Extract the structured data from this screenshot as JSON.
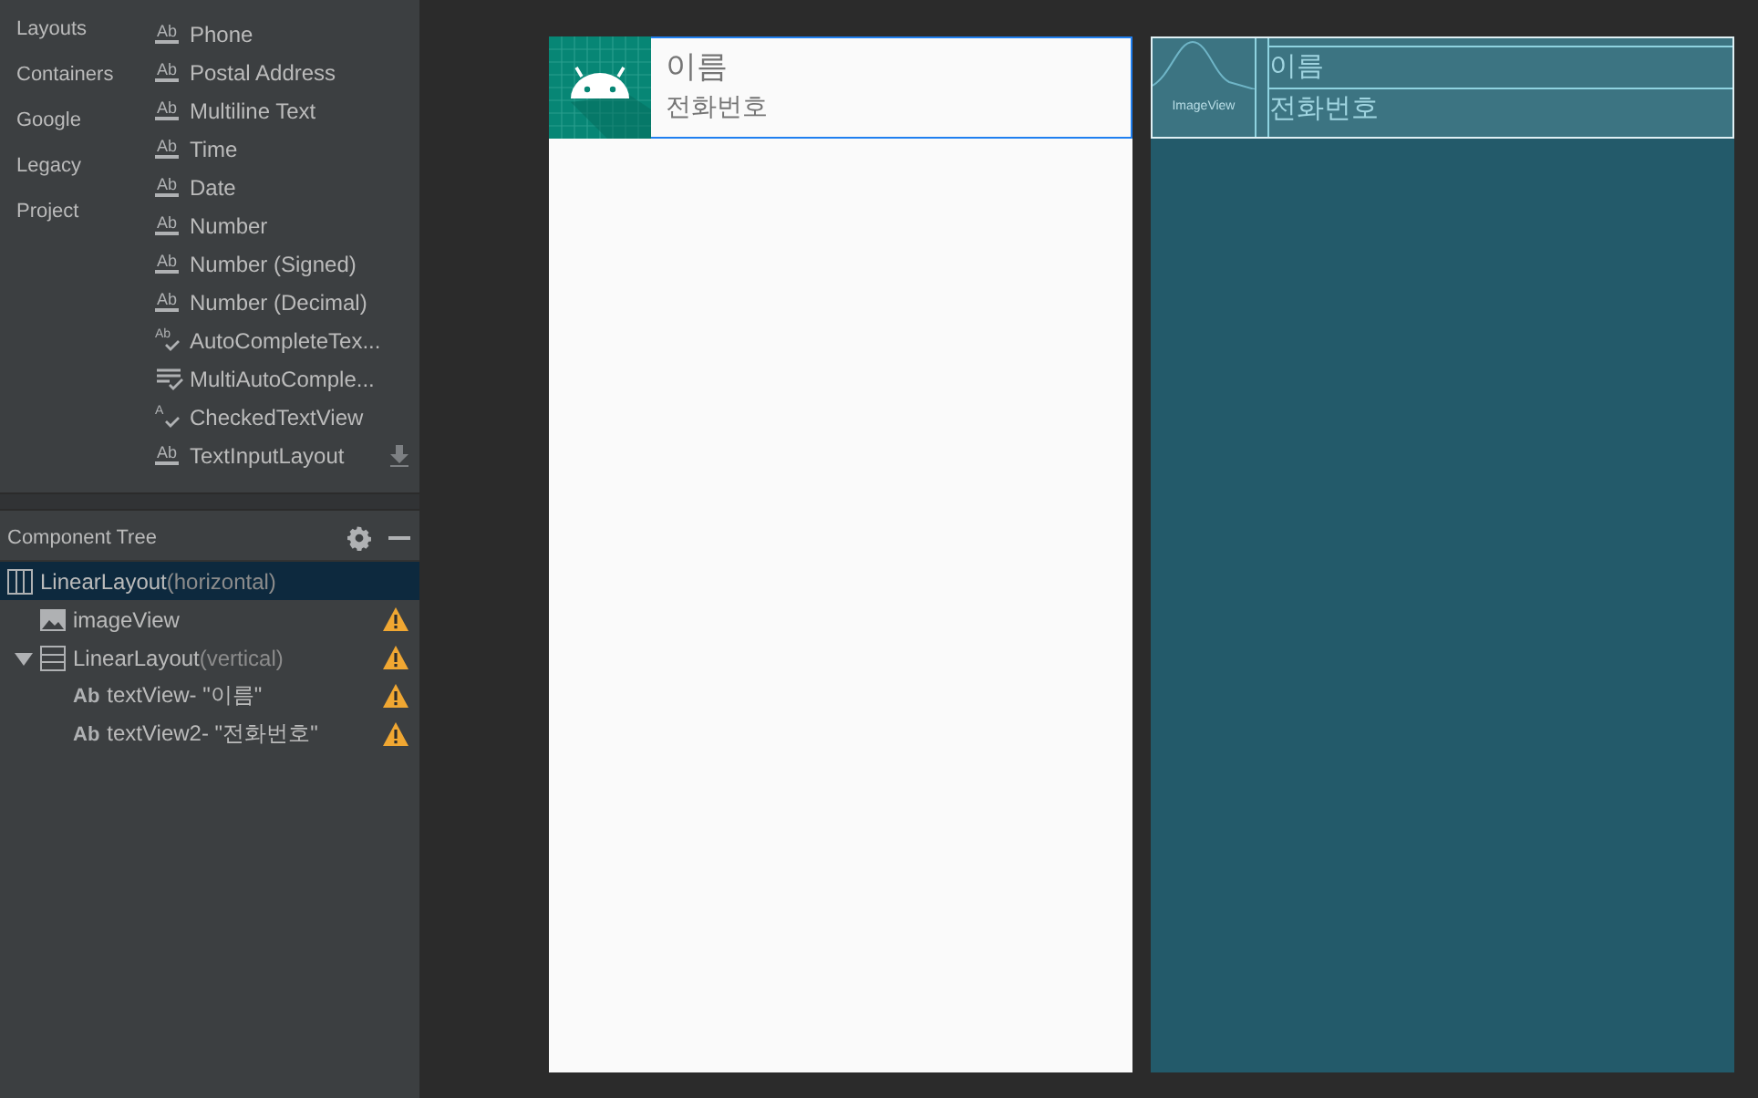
{
  "palette": {
    "categories": [
      {
        "label": "Layouts",
        "selected": false
      },
      {
        "label": "Containers",
        "selected": false
      },
      {
        "label": "Google",
        "selected": false
      },
      {
        "label": "Legacy",
        "selected": false
      },
      {
        "label": "Project",
        "selected": false
      }
    ],
    "items": [
      {
        "label": "Phone",
        "kind": "text",
        "icon": "Ab",
        "download": false
      },
      {
        "label": "Postal Address",
        "kind": "text",
        "icon": "Ab",
        "download": false
      },
      {
        "label": "Multiline Text",
        "kind": "text",
        "icon": "Ab",
        "download": false
      },
      {
        "label": "Time",
        "kind": "text",
        "icon": "Ab",
        "download": false
      },
      {
        "label": "Date",
        "kind": "text",
        "icon": "Ab",
        "download": false
      },
      {
        "label": "Number",
        "kind": "text",
        "icon": "Ab",
        "download": false
      },
      {
        "label": "Number (Signed)",
        "kind": "text",
        "icon": "Ab",
        "download": false
      },
      {
        "label": "Number (Decimal)",
        "kind": "text",
        "icon": "Ab",
        "download": false
      },
      {
        "label": "AutoCompleteTex...",
        "kind": "autocomplete",
        "icon": "Ab",
        "download": false
      },
      {
        "label": "MultiAutoComple...",
        "kind": "multi",
        "download": false
      },
      {
        "label": "CheckedTextView",
        "kind": "checked",
        "icon": "A",
        "download": false
      },
      {
        "label": "TextInputLayout",
        "kind": "text",
        "icon": "Ab",
        "download": true
      }
    ]
  },
  "component_tree": {
    "title": "Component Tree",
    "nodes": [
      {
        "name": "LinearLayout",
        "detail": "(horizontal)",
        "kind": "hlayout",
        "selected": true,
        "warning": false,
        "children": [
          {
            "name": "imageView",
            "kind": "image",
            "selected": false,
            "warning": true
          },
          {
            "name": "LinearLayout",
            "detail": "(vertical)",
            "kind": "vlayout",
            "selected": false,
            "warning": true,
            "expanded": true,
            "children": [
              {
                "name": "textView- \"이름\"",
                "kind": "text",
                "icon": "Ab",
                "selected": false,
                "warning": true
              },
              {
                "name": "textView2- \"전화번호\"",
                "kind": "text",
                "icon": "Ab",
                "selected": false,
                "warning": true
              }
            ]
          }
        ]
      }
    ]
  },
  "design": {
    "name": "이름",
    "phone": "전화번호"
  },
  "blueprint": {
    "image_label": "ImageView",
    "name": "이름",
    "phone": "전화번호"
  }
}
